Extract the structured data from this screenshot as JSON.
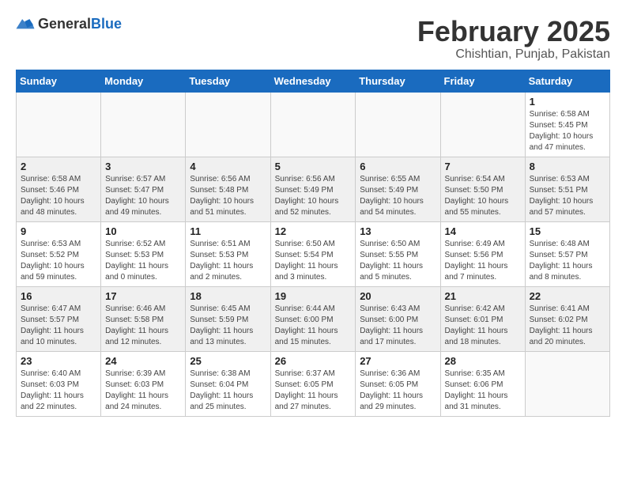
{
  "logo": {
    "text_general": "General",
    "text_blue": "Blue"
  },
  "header": {
    "month": "February 2025",
    "location": "Chishtian, Punjab, Pakistan"
  },
  "weekdays": [
    "Sunday",
    "Monday",
    "Tuesday",
    "Wednesday",
    "Thursday",
    "Friday",
    "Saturday"
  ],
  "weeks": [
    [
      {
        "day": "",
        "info": ""
      },
      {
        "day": "",
        "info": ""
      },
      {
        "day": "",
        "info": ""
      },
      {
        "day": "",
        "info": ""
      },
      {
        "day": "",
        "info": ""
      },
      {
        "day": "",
        "info": ""
      },
      {
        "day": "1",
        "info": "Sunrise: 6:58 AM\nSunset: 5:45 PM\nDaylight: 10 hours and 47 minutes."
      }
    ],
    [
      {
        "day": "2",
        "info": "Sunrise: 6:58 AM\nSunset: 5:46 PM\nDaylight: 10 hours and 48 minutes."
      },
      {
        "day": "3",
        "info": "Sunrise: 6:57 AM\nSunset: 5:47 PM\nDaylight: 10 hours and 49 minutes."
      },
      {
        "day": "4",
        "info": "Sunrise: 6:56 AM\nSunset: 5:48 PM\nDaylight: 10 hours and 51 minutes."
      },
      {
        "day": "5",
        "info": "Sunrise: 6:56 AM\nSunset: 5:49 PM\nDaylight: 10 hours and 52 minutes."
      },
      {
        "day": "6",
        "info": "Sunrise: 6:55 AM\nSunset: 5:49 PM\nDaylight: 10 hours and 54 minutes."
      },
      {
        "day": "7",
        "info": "Sunrise: 6:54 AM\nSunset: 5:50 PM\nDaylight: 10 hours and 55 minutes."
      },
      {
        "day": "8",
        "info": "Sunrise: 6:53 AM\nSunset: 5:51 PM\nDaylight: 10 hours and 57 minutes."
      }
    ],
    [
      {
        "day": "9",
        "info": "Sunrise: 6:53 AM\nSunset: 5:52 PM\nDaylight: 10 hours and 59 minutes."
      },
      {
        "day": "10",
        "info": "Sunrise: 6:52 AM\nSunset: 5:53 PM\nDaylight: 11 hours and 0 minutes."
      },
      {
        "day": "11",
        "info": "Sunrise: 6:51 AM\nSunset: 5:53 PM\nDaylight: 11 hours and 2 minutes."
      },
      {
        "day": "12",
        "info": "Sunrise: 6:50 AM\nSunset: 5:54 PM\nDaylight: 11 hours and 3 minutes."
      },
      {
        "day": "13",
        "info": "Sunrise: 6:50 AM\nSunset: 5:55 PM\nDaylight: 11 hours and 5 minutes."
      },
      {
        "day": "14",
        "info": "Sunrise: 6:49 AM\nSunset: 5:56 PM\nDaylight: 11 hours and 7 minutes."
      },
      {
        "day": "15",
        "info": "Sunrise: 6:48 AM\nSunset: 5:57 PM\nDaylight: 11 hours and 8 minutes."
      }
    ],
    [
      {
        "day": "16",
        "info": "Sunrise: 6:47 AM\nSunset: 5:57 PM\nDaylight: 11 hours and 10 minutes."
      },
      {
        "day": "17",
        "info": "Sunrise: 6:46 AM\nSunset: 5:58 PM\nDaylight: 11 hours and 12 minutes."
      },
      {
        "day": "18",
        "info": "Sunrise: 6:45 AM\nSunset: 5:59 PM\nDaylight: 11 hours and 13 minutes."
      },
      {
        "day": "19",
        "info": "Sunrise: 6:44 AM\nSunset: 6:00 PM\nDaylight: 11 hours and 15 minutes."
      },
      {
        "day": "20",
        "info": "Sunrise: 6:43 AM\nSunset: 6:00 PM\nDaylight: 11 hours and 17 minutes."
      },
      {
        "day": "21",
        "info": "Sunrise: 6:42 AM\nSunset: 6:01 PM\nDaylight: 11 hours and 18 minutes."
      },
      {
        "day": "22",
        "info": "Sunrise: 6:41 AM\nSunset: 6:02 PM\nDaylight: 11 hours and 20 minutes."
      }
    ],
    [
      {
        "day": "23",
        "info": "Sunrise: 6:40 AM\nSunset: 6:03 PM\nDaylight: 11 hours and 22 minutes."
      },
      {
        "day": "24",
        "info": "Sunrise: 6:39 AM\nSunset: 6:03 PM\nDaylight: 11 hours and 24 minutes."
      },
      {
        "day": "25",
        "info": "Sunrise: 6:38 AM\nSunset: 6:04 PM\nDaylight: 11 hours and 25 minutes."
      },
      {
        "day": "26",
        "info": "Sunrise: 6:37 AM\nSunset: 6:05 PM\nDaylight: 11 hours and 27 minutes."
      },
      {
        "day": "27",
        "info": "Sunrise: 6:36 AM\nSunset: 6:05 PM\nDaylight: 11 hours and 29 minutes."
      },
      {
        "day": "28",
        "info": "Sunrise: 6:35 AM\nSunset: 6:06 PM\nDaylight: 11 hours and 31 minutes."
      },
      {
        "day": "",
        "info": ""
      }
    ]
  ]
}
